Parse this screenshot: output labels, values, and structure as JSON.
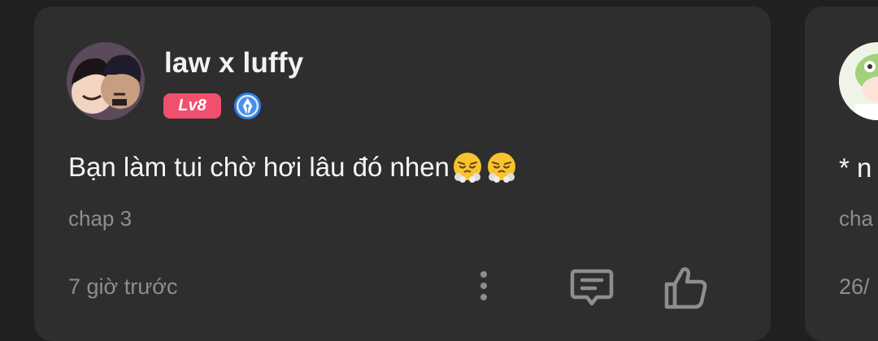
{
  "comment": {
    "username": "law x luffy",
    "level": "Lv8",
    "rank_icon": "pen-nib-badge-icon",
    "text": "Bạn làm tui chờ hơi lâu đó nhen",
    "emojis": [
      "😤",
      "😤"
    ],
    "chapter": "chap 3",
    "time": "7 giờ trước",
    "colors": {
      "level_badge": "#f0506e",
      "rank_icon": "#2f7fe0"
    }
  },
  "next_comment": {
    "text_partial": "* n",
    "chapter_partial": "cha",
    "time_partial": "26/"
  }
}
